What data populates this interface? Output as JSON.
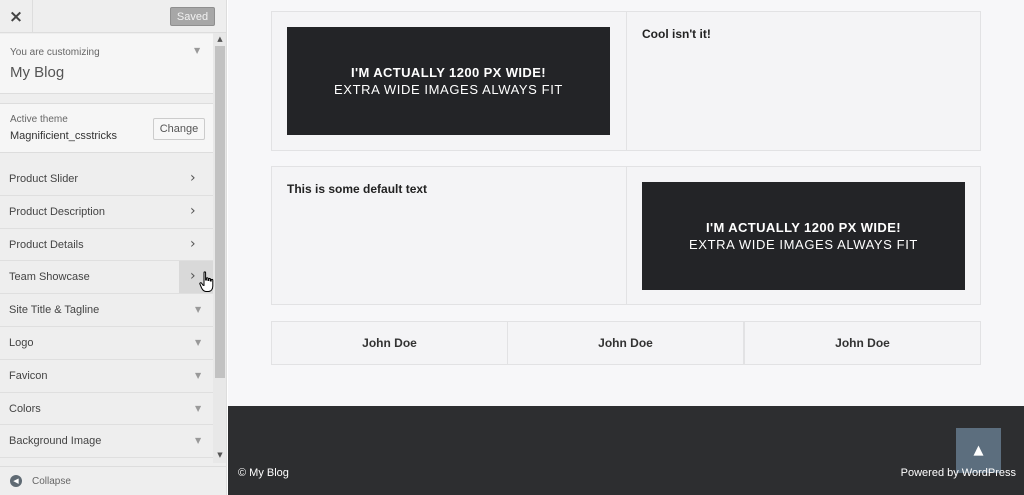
{
  "topbar": {
    "close_icon": "×",
    "saved_label": "Saved"
  },
  "customizing": {
    "label": "You are customizing",
    "site_name": "My Blog",
    "caret": "▼"
  },
  "theme": {
    "label": "Active theme",
    "name": "Magnificient_csstricks",
    "change_label": "Change"
  },
  "sections": [
    {
      "label": "Product Slider",
      "icon": "›"
    },
    {
      "label": "Product Description",
      "icon": "›"
    },
    {
      "label": "Product Details",
      "icon": "›"
    },
    {
      "label": "Team Showcase",
      "icon": "›"
    },
    {
      "label": "Site Title & Tagline",
      "icon": "▼"
    },
    {
      "label": "Logo",
      "icon": "▼"
    },
    {
      "label": "Favicon",
      "icon": "▼"
    },
    {
      "label": "Colors",
      "icon": "▼"
    },
    {
      "label": "Background Image",
      "icon": "▼"
    }
  ],
  "scroll": {
    "up": "▲",
    "down": "▼"
  },
  "collapse": {
    "icon": "◀",
    "label": "Collapse"
  },
  "preview": {
    "row1_text": "Cool isn't it!",
    "row2_text": "This is some default text",
    "banner_line1": "I'M ACTUALLY 1200 PX WIDE!",
    "banner_line2": "EXTRA WIDE IMAGES ALWAYS FIT",
    "team": [
      "John Doe",
      "John Doe",
      "John Doe"
    ]
  },
  "footer": {
    "copyright": "© My Blog",
    "powered": "Powered by WordPress",
    "back_to_top_icon": "▲"
  },
  "colors": {
    "sidebar_bg": "#eeeeee",
    "footer_bg": "#2d2e30",
    "back_to_top_bg": "#5c6e7e",
    "banner_bg": "#232427"
  }
}
